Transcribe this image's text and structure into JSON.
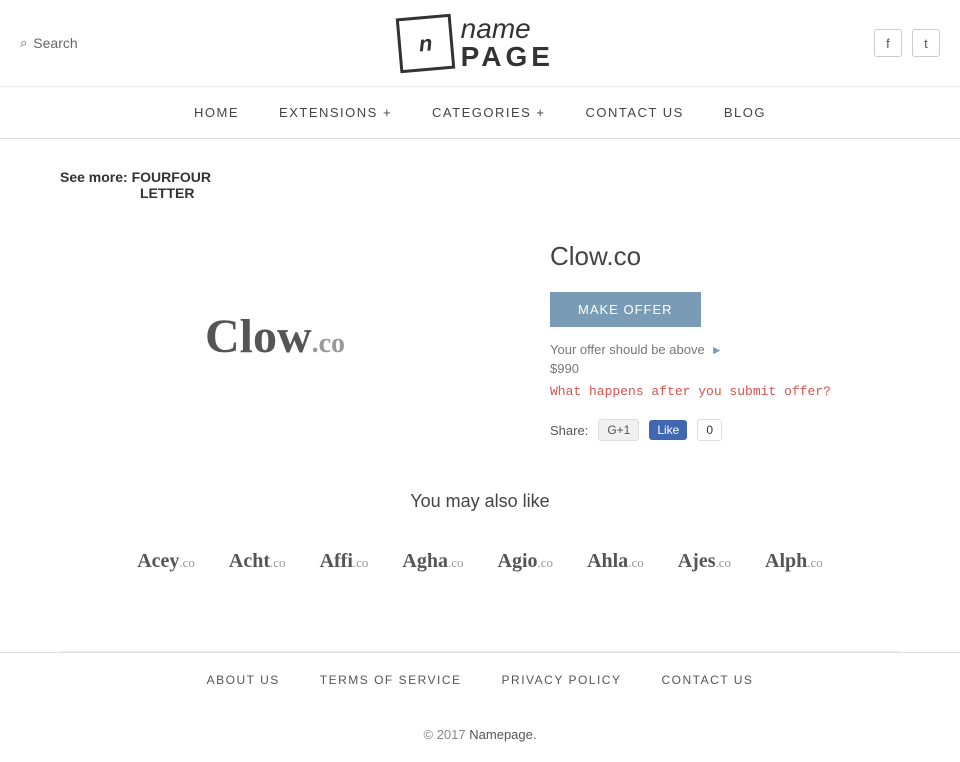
{
  "header": {
    "search_label": "Search",
    "logo_letter": "n",
    "logo_name": "name",
    "logo_page": "PAGE",
    "social": {
      "facebook_label": "f",
      "twitter_label": "t"
    }
  },
  "nav": {
    "items": [
      {
        "label": "HOME",
        "id": "home"
      },
      {
        "label": "EXTENSIONS +",
        "id": "extensions"
      },
      {
        "label": "CATEGORIES +",
        "id": "categories"
      },
      {
        "label": "CONTACT  US",
        "id": "contact"
      },
      {
        "label": "BLOG",
        "id": "blog"
      }
    ]
  },
  "breadcrumb": {
    "prefix": "See more:",
    "tag1": "FOUR",
    "tag2": "LETTER"
  },
  "domain": {
    "name": "Clow",
    "tld": ".co",
    "full": "Clow.co",
    "make_offer_label": "Make Offer",
    "offer_hint": "Your offer should be above",
    "offer_price": "$990",
    "submit_link": "What happens after you submit offer?",
    "share_label": "Share:",
    "gplus_label": "G+1",
    "fb_label": "Like",
    "fb_count": "0"
  },
  "also_like": {
    "title": "You may also like",
    "domains": [
      {
        "name": "Acey",
        "tld": ".co"
      },
      {
        "name": "Acht",
        "tld": ".co"
      },
      {
        "name": "Affi",
        "tld": ".co"
      },
      {
        "name": "Agha",
        "tld": ".co"
      },
      {
        "name": "Agio",
        "tld": ".co"
      },
      {
        "name": "Ahla",
        "tld": ".co"
      },
      {
        "name": "Ajes",
        "tld": ".co"
      },
      {
        "name": "Alph",
        "tld": ".co"
      }
    ]
  },
  "footer": {
    "links": [
      {
        "label": "ABOUT US",
        "id": "about-us"
      },
      {
        "label": "TERMS OF SERVICE",
        "id": "terms"
      },
      {
        "label": "PRIVACY POLICY",
        "id": "privacy"
      },
      {
        "label": "CONTACT US",
        "id": "contact-us"
      }
    ],
    "copy_prefix": "© 2017",
    "copy_brand": "Namepage.",
    "copy_year": "2017"
  }
}
